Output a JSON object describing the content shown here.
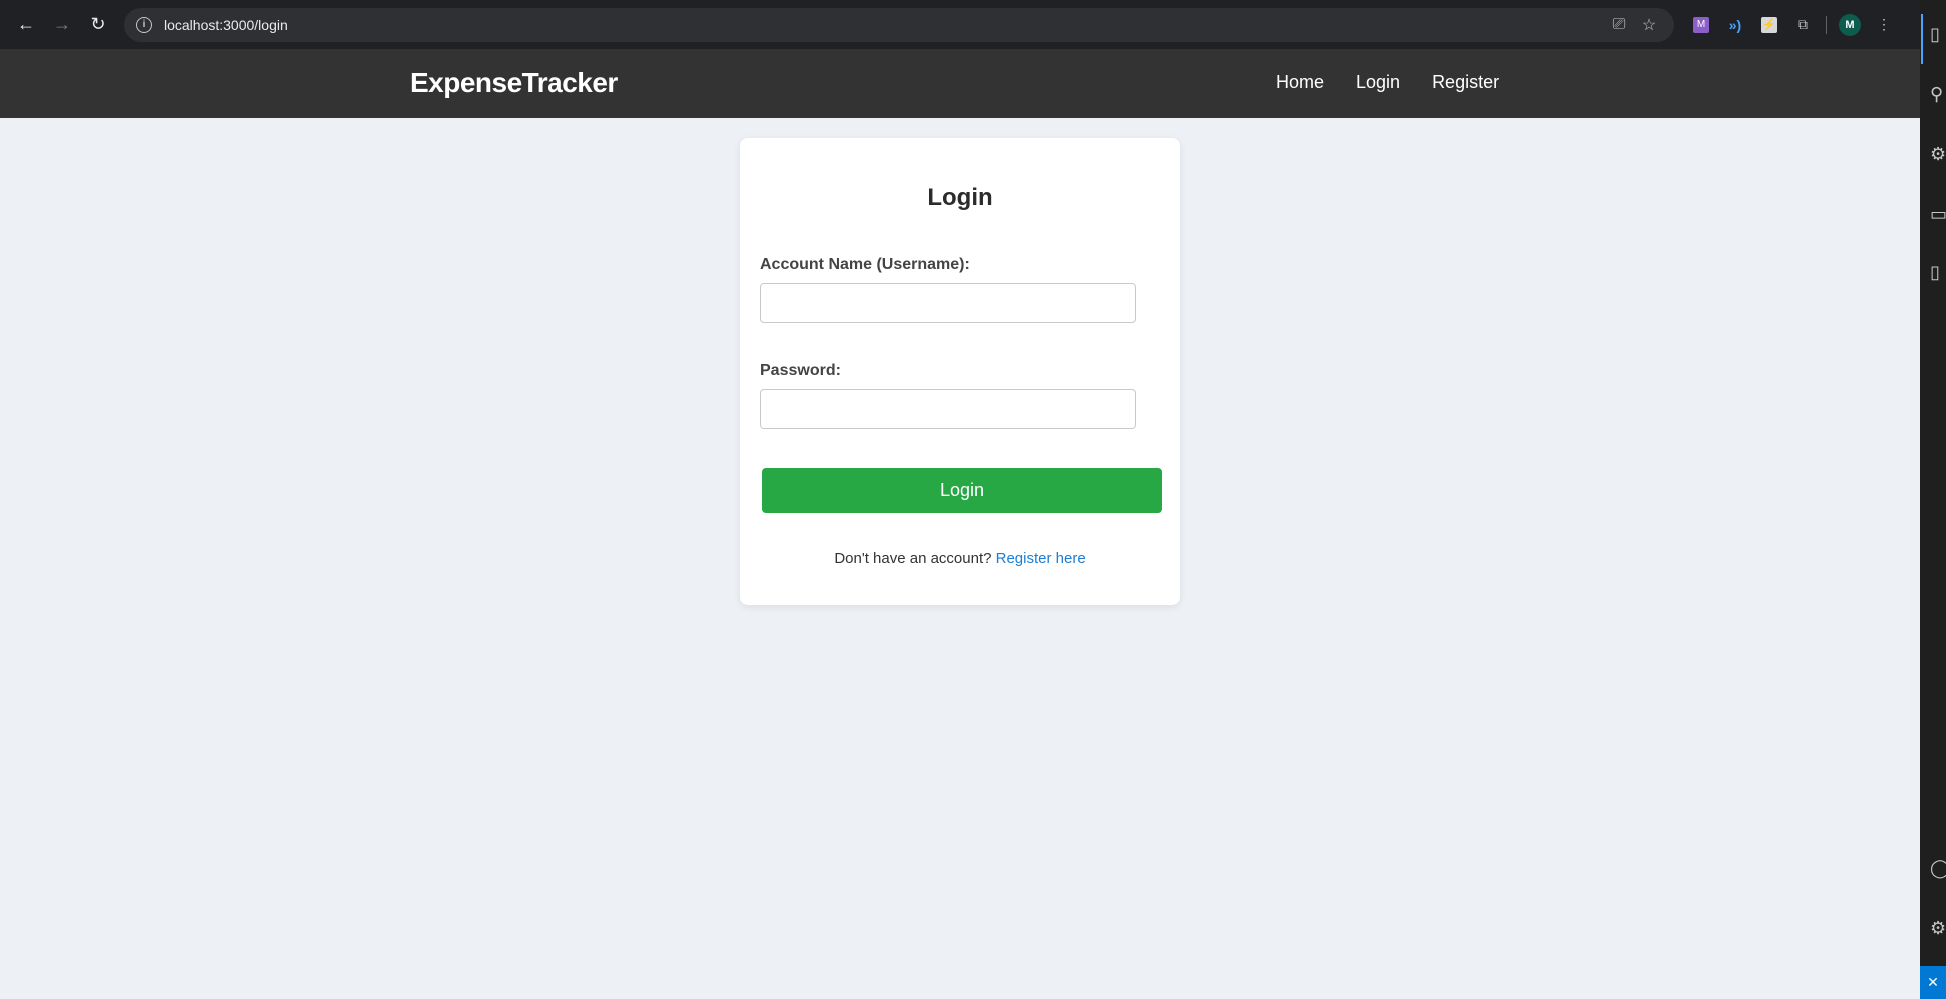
{
  "browser": {
    "url": "localhost:3000/login",
    "avatar_letter": "M",
    "extension_m_letter": "M"
  },
  "app": {
    "brand": "ExpenseTracker",
    "nav": {
      "home": "Home",
      "login": "Login",
      "register": "Register"
    }
  },
  "login_form": {
    "title": "Login",
    "username_label": "Account Name (Username):",
    "username_value": "",
    "password_label": "Password:",
    "password_value": "",
    "submit_label": "Login",
    "register_prompt": "Don't have an account?",
    "register_link": "Register here"
  },
  "colors": {
    "navbar": "#333333",
    "page_bg": "#edf0f5",
    "login_button": "#28a745",
    "link": "#1a7fd4"
  }
}
